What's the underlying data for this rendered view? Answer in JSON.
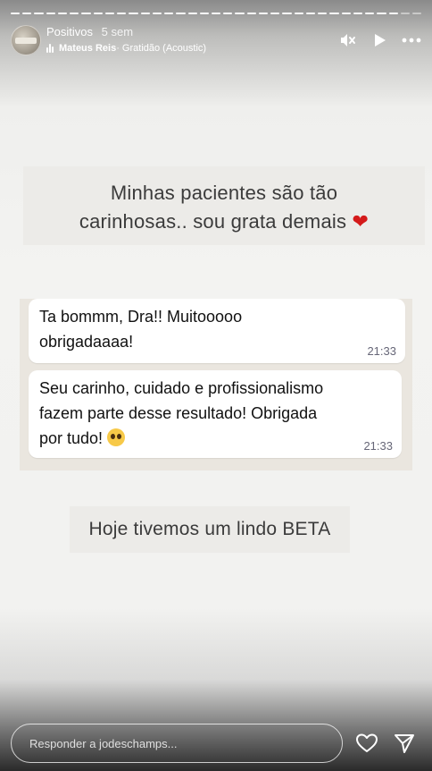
{
  "header": {
    "account": "Positivos",
    "time": "5 sem",
    "music_artist": "Mateus Reis",
    "music_title": " · Gratidão (Acoustic)"
  },
  "story": {
    "caption_top_line1": "Minhas pacientes são tão",
    "caption_top_line2": "carinhosas.. sou grata demais ",
    "caption_top_emoji": "❤",
    "caption_bottom": "Hoje tivemos um lindo BETA"
  },
  "chat": {
    "messages": [
      {
        "line1": "Ta bommm, Dra!! Muitooooo",
        "line2": "obrigadaaaa!",
        "time": "21:33"
      },
      {
        "line1": "Seu carinho, cuidado e profissionalismo",
        "line2": "fazem parte desse resultado! Obrigada",
        "line3": "por tudo! ",
        "time": "21:33"
      }
    ]
  },
  "footer": {
    "reply_placeholder": "Responder a jodeschamps..."
  },
  "icons": {
    "mute": "speaker-mute-icon",
    "play": "play-icon",
    "more": "more-icon",
    "heart": "heart-icon",
    "send": "send-icon"
  }
}
